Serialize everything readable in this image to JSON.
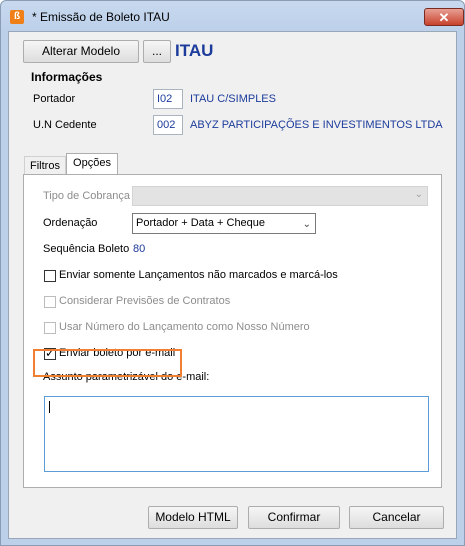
{
  "window": {
    "title": "* Emissão de Boleto ITAU",
    "app_icon_glyph": "ß",
    "close_glyph": "✕"
  },
  "toolbar": {
    "alter_model_label": "Alterar Modelo",
    "ellipsis_label": "...",
    "bank_name": "ITAU"
  },
  "info": {
    "title": "Informações",
    "portador_label": "Portador",
    "portador_code": "I02",
    "portador_name": "ITAU C/SIMPLES",
    "cedente_label": "U.N Cedente",
    "cedente_code": "002",
    "cedente_name": "ABYZ PARTICIPAÇÕES E INVESTIMENTOS LTDA"
  },
  "tabs": [
    {
      "label": "Filtros",
      "active": false
    },
    {
      "label": "Opções",
      "active": true
    }
  ],
  "options": {
    "tipo_cobranca_label": "Tipo de Cobrança",
    "tipo_cobranca_value": "",
    "ordenacao_label": "Ordenação",
    "ordenacao_value": "Portador + Data + Cheque",
    "sequencia_label": "Sequência Boleto",
    "sequencia_value": "80",
    "checkboxes": [
      {
        "label": "Enviar somente Lançamentos não marcados e marcá-los",
        "checked": false,
        "enabled": true
      },
      {
        "label": "Considerar Previsões de Contratos",
        "checked": false,
        "enabled": false
      },
      {
        "label": "Usar Número do Lançamento como Nosso Número",
        "checked": false,
        "enabled": false
      },
      {
        "label": "Enviar boleto por e-mail",
        "checked": true,
        "enabled": true
      }
    ],
    "email_subject_label": "Assunto parametrizável do e-mail:",
    "email_subject_value": ""
  },
  "footer": {
    "modelo_html_label": "Modelo HTML",
    "confirmar_label": "Confirmar",
    "cancelar_label": "Cancelar"
  },
  "colors": {
    "accent_blue": "#1c3b9b",
    "highlight_orange": "#f07f32",
    "close_red": "#c8412c"
  },
  "icons": {
    "check": "✓",
    "chevron": "⌄"
  }
}
